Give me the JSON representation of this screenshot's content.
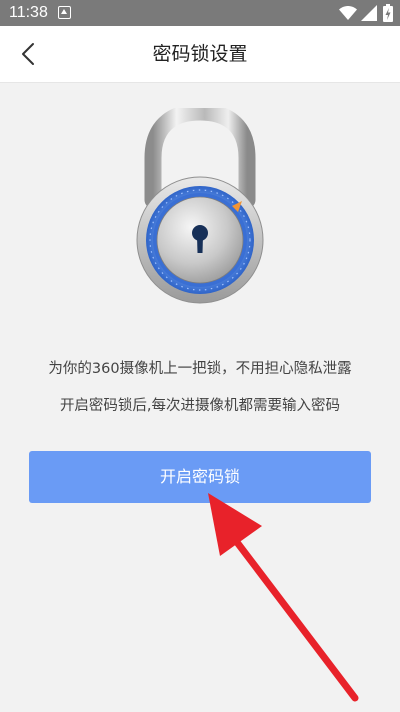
{
  "status_bar": {
    "time": "11:38",
    "icons": [
      "app-notification-icon",
      "wifi-icon",
      "cellular-signal-icon",
      "battery-charging-icon"
    ]
  },
  "header": {
    "title": "密码锁设置",
    "back_icon": "chevron-left-icon"
  },
  "illustration": {
    "icon": "padlock-icon"
  },
  "description": {
    "line1": "为你的360摄像机上一把锁，不用担心隐私泄露",
    "line2": "开启密码锁后,每次进摄像机都需要输入密码"
  },
  "actions": {
    "enable_label": "开启密码锁"
  },
  "colors": {
    "status_bar": "#7a7a7a",
    "primary_button": "#6a9bf5",
    "background": "#f2f2f2",
    "annotation_arrow": "#e8222a"
  }
}
